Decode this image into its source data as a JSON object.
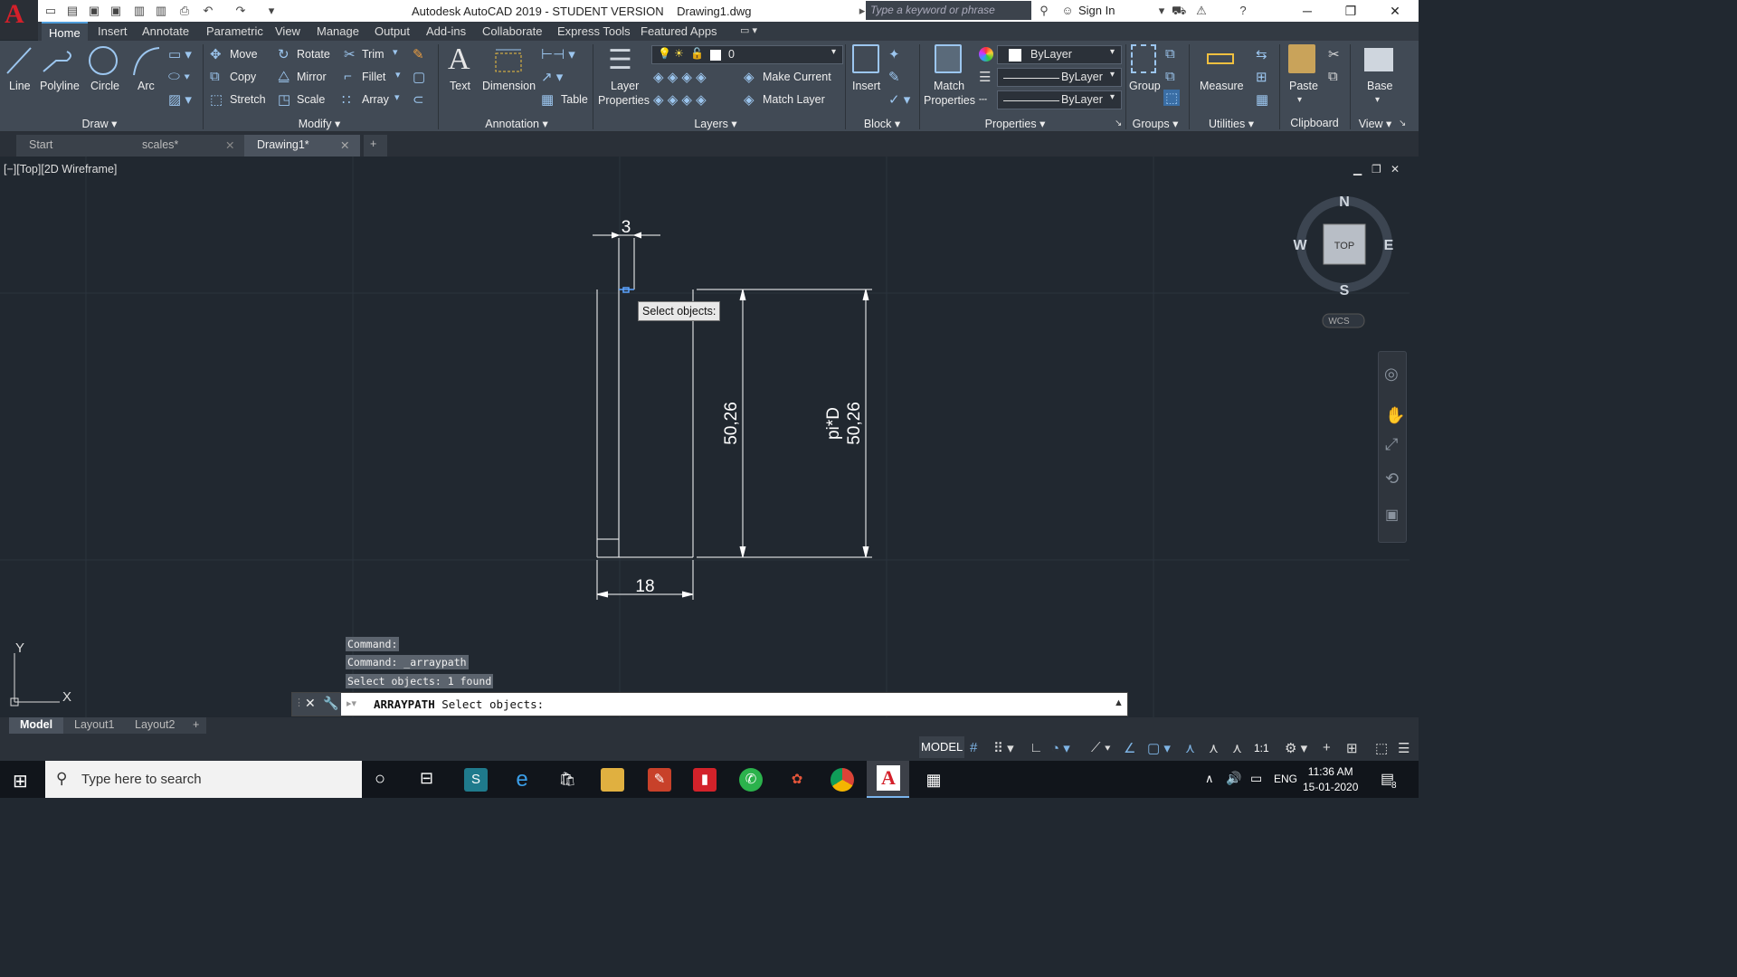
{
  "title_bar": {
    "title": "Autodesk AutoCAD 2019 - STUDENT VERSION    Drawing1.dwg",
    "search_placeholder": "Type a keyword or phrase",
    "sign_in": "Sign In"
  },
  "ribbon_tabs": [
    "Home",
    "Insert",
    "Annotate",
    "Parametric",
    "View",
    "Manage",
    "Output",
    "Add-ins",
    "Collaborate",
    "Express Tools",
    "Featured Apps"
  ],
  "draw_panel": {
    "title": "Draw",
    "line": "Line",
    "polyline": "Polyline",
    "circle": "Circle",
    "arc": "Arc"
  },
  "modify_panel": {
    "title": "Modify",
    "move": "Move",
    "rotate": "Rotate",
    "trim": "Trim",
    "copy": "Copy",
    "mirror": "Mirror",
    "fillet": "Fillet",
    "stretch": "Stretch",
    "scale": "Scale",
    "array": "Array"
  },
  "annotation_panel": {
    "title": "Annotation",
    "text": "Text",
    "dimension": "Dimension",
    "table": "Table"
  },
  "layers_panel": {
    "title": "Layers",
    "layer_properties_1": "Layer",
    "layer_properties_2": "Properties",
    "current_layer": "0",
    "make_current": "Make Current",
    "match_layer": "Match Layer"
  },
  "block_panel": {
    "title": "Block",
    "insert": "Insert"
  },
  "properties_panel": {
    "title": "Properties",
    "match_1": "Match",
    "match_2": "Properties",
    "color": "ByLayer",
    "linetype": "ByLayer",
    "lineweight": "ByLayer"
  },
  "groups_panel": {
    "title": "Groups",
    "group": "Group"
  },
  "utilities_panel": {
    "title": "Utilities",
    "measure": "Measure"
  },
  "clipboard_panel": {
    "title": "Clipboard",
    "paste": "Paste"
  },
  "view_panel": {
    "title": "View",
    "base": "Base"
  },
  "doc_tabs": [
    "Start",
    "scales*",
    "Drawing1*"
  ],
  "viewport_label": "[−][Top][2D Wireframe]",
  "drawing": {
    "dim_top": "3",
    "dim_bottom": "18",
    "dim_mid": "50,26",
    "dim_right_1": "pi*D",
    "dim_right_2": "50,26"
  },
  "tooltip": "Select objects:",
  "viewcube": {
    "n": "N",
    "s": "S",
    "e": "E",
    "w": "W",
    "top": "TOP",
    "wcs": "WCS"
  },
  "ucs": {
    "x": "X",
    "y": "Y"
  },
  "command_history": [
    "Command:",
    "Command: _arraypath",
    "Select objects: 1 found"
  ],
  "command_line": {
    "command": "ARRAYPATH",
    "prompt": "Select objects:"
  },
  "layout_tabs": [
    "Model",
    "Layout1",
    "Layout2"
  ],
  "status_bar": {
    "model": "MODEL",
    "scale": "1:1"
  },
  "taskbar": {
    "search_placeholder": "Type here to search",
    "language": "ENG",
    "time": "11:36 AM",
    "date": "15-01-2020",
    "notifications": "8"
  }
}
